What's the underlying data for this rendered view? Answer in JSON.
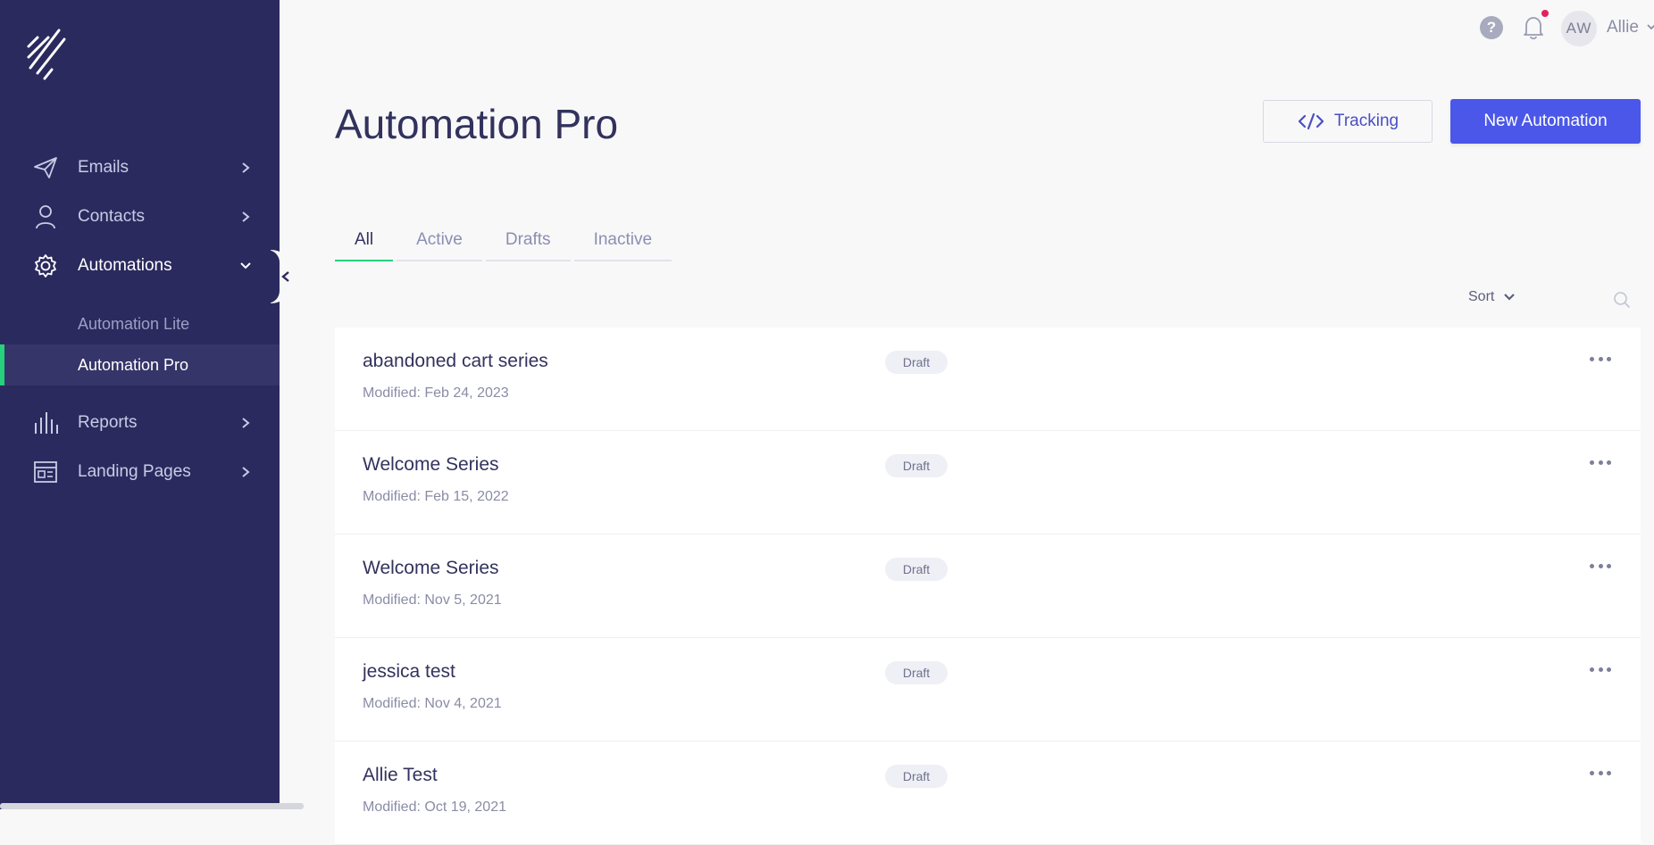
{
  "sidebar": {
    "items": [
      {
        "label": "Emails",
        "icon": "paper-plane-icon"
      },
      {
        "label": "Contacts",
        "icon": "user-icon"
      },
      {
        "label": "Automations",
        "icon": "gear-icon"
      },
      {
        "label": "Reports",
        "icon": "bar-chart-icon"
      },
      {
        "label": "Landing Pages",
        "icon": "layout-icon"
      }
    ],
    "subitems": [
      {
        "label": "Automation Lite"
      },
      {
        "label": "Automation Pro"
      }
    ]
  },
  "topbar": {
    "help": "?",
    "avatar_initials": "AW",
    "user_name": "Allie"
  },
  "header": {
    "title": "Automation Pro",
    "tracking_label": "Tracking",
    "new_label": "New Automation"
  },
  "tabs": [
    {
      "label": "All"
    },
    {
      "label": "Active"
    },
    {
      "label": "Drafts"
    },
    {
      "label": "Inactive"
    }
  ],
  "sort_label": "Sort",
  "automations": [
    {
      "name": "abandoned cart series",
      "modified": "Modified: Feb 24, 2023",
      "status": "Draft"
    },
    {
      "name": "Welcome Series",
      "modified": "Modified: Feb 15, 2022",
      "status": "Draft"
    },
    {
      "name": "Welcome Series",
      "modified": "Modified: Nov 5, 2021",
      "status": "Draft"
    },
    {
      "name": "jessica test",
      "modified": "Modified: Nov 4, 2021",
      "status": "Draft"
    },
    {
      "name": "Allie Test",
      "modified": "Modified: Oct 19, 2021",
      "status": "Draft"
    }
  ],
  "colors": {
    "sidebar_bg": "#2b2a5e",
    "accent_green": "#26d07c",
    "primary_button": "#4a57e8",
    "notification_dot": "#e0245e"
  }
}
